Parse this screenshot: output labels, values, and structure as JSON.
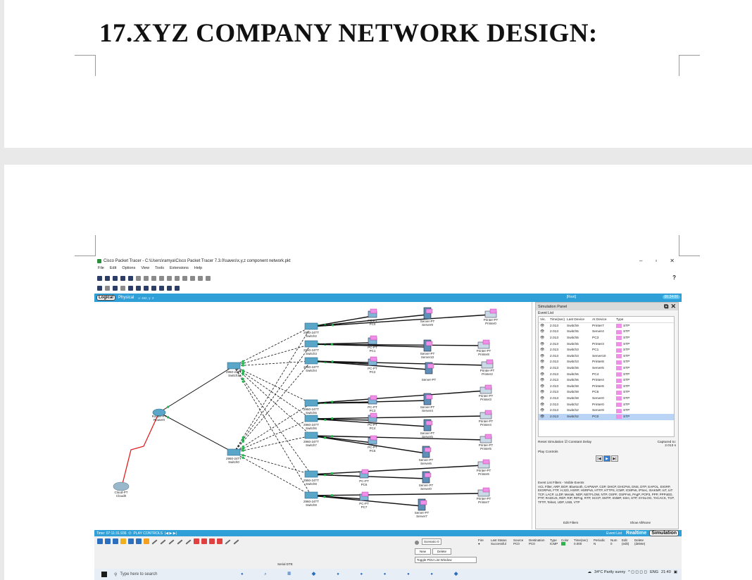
{
  "document": {
    "title": "17.XYZ COMPANY NETWORK DESIGN:"
  },
  "app": {
    "window_title": "Cisco Packet Tracer - C:\\Users\\ramya\\Cisco Packet Tracer 7.3.0\\saves\\x,y,z component network.pkt",
    "menu": [
      "File",
      "Edit",
      "Options",
      "View",
      "Tools",
      "Extensions",
      "Help"
    ],
    "help": "?",
    "win_controls": [
      "–",
      "▫",
      "✕"
    ]
  },
  "viewbar": {
    "logical": "Logical",
    "physical": "Physical",
    "coord": "x: 452, y: 3",
    "root": "[Root]",
    "clock": "06:24:00"
  },
  "topology": {
    "devices": [
      {
        "name": "Switch2",
        "model": "2960-24TT"
      },
      {
        "name": "Switch3",
        "model": "2960-24TT"
      },
      {
        "name": "Switch4",
        "model": "2960-24TT"
      },
      {
        "name": "Switch5",
        "model": "2960-24TT"
      },
      {
        "name": "Switch6",
        "model": "2960-24TT"
      },
      {
        "name": "Switch7",
        "model": "2960-24TT"
      },
      {
        "name": "Switch8",
        "model": "2960-24TT"
      },
      {
        "name": "Switch9",
        "model": "2960-24TT"
      },
      {
        "name": "Switch1",
        "model": "2960-24TT"
      },
      {
        "name": "Switch0",
        "model": "2960-24TT"
      },
      {
        "name": "Router0",
        "model": "Router-PT"
      },
      {
        "name": "Cloud0",
        "model": "Cloud-PT"
      },
      {
        "name": "PC0",
        "model": "PC-PT"
      },
      {
        "name": "PC1",
        "model": "PC-PT"
      },
      {
        "name": "PC2",
        "model": "PC-PT"
      },
      {
        "name": "PC3",
        "model": "PC-PT"
      },
      {
        "name": "PC4",
        "model": "PC-PT"
      },
      {
        "name": "PC5",
        "model": "PC-PT"
      },
      {
        "name": "PC6",
        "model": "PC-PT"
      },
      {
        "name": "PC7",
        "model": "PC-PT"
      },
      {
        "name": "Server9",
        "model": "Server-PT"
      },
      {
        "name": "Server10",
        "model": "Server-PT"
      },
      {
        "name": "Server-PT",
        "model": ""
      },
      {
        "name": "Server4",
        "model": "Server-PT"
      },
      {
        "name": "Server5",
        "model": "Server-PT"
      },
      {
        "name": "Server6",
        "model": "Server-PT"
      },
      {
        "name": "Server0",
        "model": "Server-PT"
      },
      {
        "name": "Server7",
        "model": "Server-PT"
      },
      {
        "name": "Printer0",
        "model": "Printer-PT"
      },
      {
        "name": "Printer8",
        "model": "Printer-PT"
      },
      {
        "name": "Printer2",
        "model": "Printer-PT"
      },
      {
        "name": "Printer3",
        "model": "Printer-PT"
      },
      {
        "name": "Printer4",
        "model": "Printer-PT"
      },
      {
        "name": "Printer5",
        "model": "Printer-PT"
      },
      {
        "name": "Printer6",
        "model": "Printer-PT"
      },
      {
        "name": "Printer7",
        "model": "Printer-PT"
      }
    ]
  },
  "simulation": {
    "panel_title": "Simulation Panel",
    "event_list_label": "Event List",
    "columns": [
      "Vis.",
      "Time(sec)",
      "Last Device",
      "At Device",
      "Type"
    ],
    "events": [
      {
        "time": "2.013",
        "last": "Switch9",
        "at": "Printer7",
        "type": "STP"
      },
      {
        "time": "2.013",
        "last": "Switch5",
        "at": "Server4",
        "type": "STP"
      },
      {
        "time": "2.013",
        "last": "Switch5",
        "at": "PC3",
        "type": "STP"
      },
      {
        "time": "2.013",
        "last": "Switch5",
        "at": "Printer3",
        "type": "STP"
      },
      {
        "time": "2.013",
        "last": "Switch3",
        "at": "PC1",
        "type": "STP"
      },
      {
        "time": "2.013",
        "last": "Switch3",
        "at": "Server10",
        "type": "STP"
      },
      {
        "time": "2.013",
        "last": "Switch3",
        "at": "Printer8",
        "type": "STP"
      },
      {
        "time": "2.013",
        "last": "Switch6",
        "at": "Server5",
        "type": "STP"
      },
      {
        "time": "2.013",
        "last": "Switch6",
        "at": "PC4",
        "type": "STP"
      },
      {
        "time": "2.013",
        "last": "Switch6",
        "at": "Printer4",
        "type": "STP"
      },
      {
        "time": "2.013",
        "last": "Switch8",
        "at": "Printer6",
        "type": "STP"
      },
      {
        "time": "2.013",
        "last": "Switch8",
        "at": "PC6",
        "type": "STP"
      },
      {
        "time": "2.013",
        "last": "Switch8",
        "at": "Server0",
        "type": "STP"
      },
      {
        "time": "2.013",
        "last": "Switch2",
        "at": "Printer0",
        "type": "STP"
      },
      {
        "time": "2.013",
        "last": "Switch2",
        "at": "Server9",
        "type": "STP"
      },
      {
        "time": "2.013",
        "last": "Switch2",
        "at": "PC0",
        "type": "STP"
      }
    ],
    "reset_label": "Reset Simulation",
    "constant_delay": "Constant Delay",
    "captured_label": "Captured to:",
    "captured_value": "2.013 s",
    "play_controls": "Play Controls",
    "filters_title": "Event List Filters - Visible Events",
    "filters_text": "ACL Filter, ARP, BGP, Bluetooth, CAPWAP, CDP, DHCP, DHCPv6, DNS, DTP, EAPOL, EIGRP, EIGRPv6, FTP, H.323, HSRP, HSRPv6, HTTP, HTTPS, ICMP, ICMPv6, IPSec, ISAKMP, IoT, IoT TCP, LACP, LLDP, Meraki, NDP, NETFLOW, NTP, OSPF, OSPFv6, PAgP, POP3, PPP, PPPoED, PTP, RADIUS, REP, RIP, RIPng, RTP, SCCP, SMTP, SNMP, SSH, STP, SYSLOG, TACACS, TCP, TFTP, Telnet, UDP, USB, VTP",
    "edit_filters": "Edit Filters",
    "show_all": "Show All/None"
  },
  "statusbar": {
    "time": "Time: 07:11:31.936",
    "play_controls": "PLAY CONTROLS",
    "event_list": "Event List",
    "realtime": "Realtime",
    "simulation": "Simulation"
  },
  "bottom": {
    "connection_label": "Serial DTE",
    "scenario": "Scenario 0",
    "new": "New",
    "delete": "Delete",
    "toggle_pdu": "Toggle PDU List Window",
    "pdu_columns": [
      "Fire",
      "Last Status",
      "Source",
      "Destination",
      "Type",
      "Color",
      "Time(sec)",
      "Periodic",
      "Num",
      "Edit",
      "Delete"
    ],
    "pdu_row": {
      "fire": "",
      "status": "Successful",
      "source": "PC0",
      "destination": "PC0",
      "type": "ICMP",
      "color": "#2fb34a",
      "time": "0.000",
      "periodic": "N",
      "num": "0",
      "edit": "(edit)",
      "delete": "(delete)"
    }
  },
  "taskbar": {
    "search_placeholder": "Type here to search",
    "weather": "34°C  Partly sunny",
    "lang": "ENG",
    "time": "21:40"
  }
}
